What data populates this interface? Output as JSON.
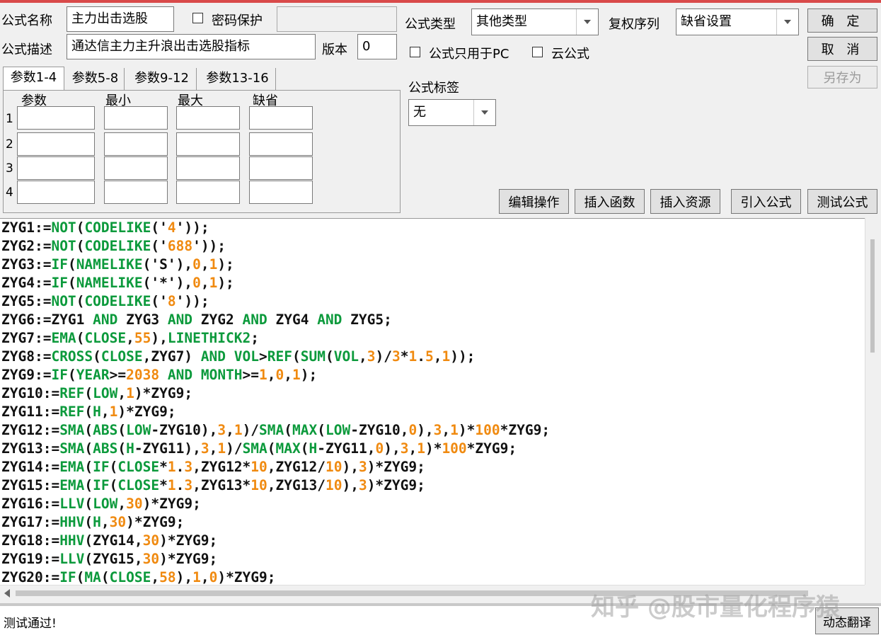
{
  "header": {
    "name_label": "公式名称",
    "name_value": "主力出击选股",
    "password_label": "密码保护",
    "desc_label": "公式描述",
    "desc_value": "通达信主力主升浪出击选股指标",
    "version_label": "版本",
    "version_value": "0",
    "type_label": "公式类型",
    "type_value": "其他类型",
    "rights_label": "复权序列",
    "rights_value": "缺省设置",
    "pc_only_label": "公式只用于PC",
    "cloud_label": "云公式",
    "tag_label": "公式标签",
    "tag_value": "无"
  },
  "buttons": {
    "ok": "确 定",
    "cancel": "取 消",
    "save_as": "另存为",
    "edit_ops": "编辑操作",
    "insert_func": "插入函数",
    "insert_res": "插入资源",
    "import_formula": "引入公式",
    "test_formula": "测试公式",
    "dynamic_translate": "动态翻译"
  },
  "param_tabs": [
    "参数1-4",
    "参数5-8",
    "参数9-12",
    "参数13-16"
  ],
  "param_headers": [
    "参数",
    "最小",
    "最大",
    "缺省"
  ],
  "param_rows": [
    "1",
    "2",
    "3",
    "4"
  ],
  "code_lines": [
    [
      [
        "t",
        "ZYG1:="
      ],
      [
        "f",
        "NOT"
      ],
      [
        "t",
        "("
      ],
      [
        "f",
        "CODELIKE"
      ],
      [
        "t",
        "('"
      ],
      [
        "n",
        "4"
      ],
      [
        "t",
        "'));"
      ]
    ],
    [
      [
        "t",
        "ZYG2:="
      ],
      [
        "f",
        "NOT"
      ],
      [
        "t",
        "("
      ],
      [
        "f",
        "CODELIKE"
      ],
      [
        "t",
        "('"
      ],
      [
        "n",
        "688"
      ],
      [
        "t",
        "'));"
      ]
    ],
    [
      [
        "t",
        "ZYG3:="
      ],
      [
        "f",
        "IF"
      ],
      [
        "t",
        "("
      ],
      [
        "f",
        "NAMELIKE"
      ],
      [
        "t",
        "('S'),"
      ],
      [
        "n",
        "0"
      ],
      [
        "t",
        ","
      ],
      [
        "n",
        "1"
      ],
      [
        "t",
        ");"
      ]
    ],
    [
      [
        "t",
        "ZYG4:="
      ],
      [
        "f",
        "IF"
      ],
      [
        "t",
        "("
      ],
      [
        "f",
        "NAMELIKE"
      ],
      [
        "t",
        "('*'),"
      ],
      [
        "n",
        "0"
      ],
      [
        "t",
        ","
      ],
      [
        "n",
        "1"
      ],
      [
        "t",
        ");"
      ]
    ],
    [
      [
        "t",
        "ZYG5:="
      ],
      [
        "f",
        "NOT"
      ],
      [
        "t",
        "("
      ],
      [
        "f",
        "CODELIKE"
      ],
      [
        "t",
        "('"
      ],
      [
        "n",
        "8"
      ],
      [
        "t",
        "'));"
      ]
    ],
    [
      [
        "t",
        "ZYG6:=ZYG1 "
      ],
      [
        "f",
        "AND"
      ],
      [
        "t",
        " ZYG3 "
      ],
      [
        "f",
        "AND"
      ],
      [
        "t",
        " ZYG2 "
      ],
      [
        "f",
        "AND"
      ],
      [
        "t",
        " ZYG4 "
      ],
      [
        "f",
        "AND"
      ],
      [
        "t",
        " ZYG5;"
      ]
    ],
    [
      [
        "t",
        "ZYG7:="
      ],
      [
        "f",
        "EMA"
      ],
      [
        "t",
        "("
      ],
      [
        "f",
        "CLOSE"
      ],
      [
        "t",
        ","
      ],
      [
        "n",
        "55"
      ],
      [
        "t",
        "),"
      ],
      [
        "f",
        "LINETHICK2"
      ],
      [
        "t",
        ";"
      ]
    ],
    [
      [
        "t",
        "ZYG8:="
      ],
      [
        "f",
        "CROSS"
      ],
      [
        "t",
        "("
      ],
      [
        "f",
        "CLOSE"
      ],
      [
        "t",
        ",ZYG7) "
      ],
      [
        "f",
        "AND"
      ],
      [
        "t",
        " "
      ],
      [
        "f",
        "VOL"
      ],
      [
        "t",
        ">"
      ],
      [
        "f",
        "REF"
      ],
      [
        "t",
        "("
      ],
      [
        "f",
        "SUM"
      ],
      [
        "t",
        "("
      ],
      [
        "f",
        "VOL"
      ],
      [
        "t",
        ","
      ],
      [
        "n",
        "3"
      ],
      [
        "t",
        ")/"
      ],
      [
        "n",
        "3"
      ],
      [
        "t",
        "*"
      ],
      [
        "n",
        "1"
      ],
      [
        "t",
        "."
      ],
      [
        "n",
        "5"
      ],
      [
        "t",
        ","
      ],
      [
        "n",
        "1"
      ],
      [
        "t",
        "));"
      ]
    ],
    [
      [
        "t",
        "ZYG9:="
      ],
      [
        "f",
        "IF"
      ],
      [
        "t",
        "("
      ],
      [
        "f",
        "YEAR"
      ],
      [
        "t",
        ">="
      ],
      [
        "n",
        "2038"
      ],
      [
        "t",
        " "
      ],
      [
        "f",
        "AND"
      ],
      [
        "t",
        " "
      ],
      [
        "f",
        "MONTH"
      ],
      [
        "t",
        ">="
      ],
      [
        "n",
        "1"
      ],
      [
        "t",
        ","
      ],
      [
        "n",
        "0"
      ],
      [
        "t",
        ","
      ],
      [
        "n",
        "1"
      ],
      [
        "t",
        ");"
      ]
    ],
    [
      [
        "t",
        "ZYG10:="
      ],
      [
        "f",
        "REF"
      ],
      [
        "t",
        "("
      ],
      [
        "f",
        "LOW"
      ],
      [
        "t",
        ","
      ],
      [
        "n",
        "1"
      ],
      [
        "t",
        ")*ZYG9;"
      ]
    ],
    [
      [
        "t",
        "ZYG11:="
      ],
      [
        "f",
        "REF"
      ],
      [
        "t",
        "("
      ],
      [
        "f",
        "H"
      ],
      [
        "t",
        ","
      ],
      [
        "n",
        "1"
      ],
      [
        "t",
        ")*ZYG9;"
      ]
    ],
    [
      [
        "t",
        "ZYG12:="
      ],
      [
        "f",
        "SMA"
      ],
      [
        "t",
        "("
      ],
      [
        "f",
        "ABS"
      ],
      [
        "t",
        "("
      ],
      [
        "f",
        "LOW"
      ],
      [
        "t",
        "-ZYG10),"
      ],
      [
        "n",
        "3"
      ],
      [
        "t",
        ","
      ],
      [
        "n",
        "1"
      ],
      [
        "t",
        ")/"
      ],
      [
        "f",
        "SMA"
      ],
      [
        "t",
        "("
      ],
      [
        "f",
        "MAX"
      ],
      [
        "t",
        "("
      ],
      [
        "f",
        "LOW"
      ],
      [
        "t",
        "-ZYG10,"
      ],
      [
        "n",
        "0"
      ],
      [
        "t",
        "),"
      ],
      [
        "n",
        "3"
      ],
      [
        "t",
        ","
      ],
      [
        "n",
        "1"
      ],
      [
        "t",
        ")*"
      ],
      [
        "n",
        "100"
      ],
      [
        "t",
        "*ZYG9;"
      ]
    ],
    [
      [
        "t",
        "ZYG13:="
      ],
      [
        "f",
        "SMA"
      ],
      [
        "t",
        "("
      ],
      [
        "f",
        "ABS"
      ],
      [
        "t",
        "("
      ],
      [
        "f",
        "H"
      ],
      [
        "t",
        "-ZYG11),"
      ],
      [
        "n",
        "3"
      ],
      [
        "t",
        ","
      ],
      [
        "n",
        "1"
      ],
      [
        "t",
        ")/"
      ],
      [
        "f",
        "SMA"
      ],
      [
        "t",
        "("
      ],
      [
        "f",
        "MAX"
      ],
      [
        "t",
        "("
      ],
      [
        "f",
        "H"
      ],
      [
        "t",
        "-ZYG11,"
      ],
      [
        "n",
        "0"
      ],
      [
        "t",
        "),"
      ],
      [
        "n",
        "3"
      ],
      [
        "t",
        ","
      ],
      [
        "n",
        "1"
      ],
      [
        "t",
        ")*"
      ],
      [
        "n",
        "100"
      ],
      [
        "t",
        "*ZYG9;"
      ]
    ],
    [
      [
        "t",
        "ZYG14:="
      ],
      [
        "f",
        "EMA"
      ],
      [
        "t",
        "("
      ],
      [
        "f",
        "IF"
      ],
      [
        "t",
        "("
      ],
      [
        "f",
        "CLOSE"
      ],
      [
        "t",
        "*"
      ],
      [
        "n",
        "1"
      ],
      [
        "t",
        "."
      ],
      [
        "n",
        "3"
      ],
      [
        "t",
        ",ZYG12*"
      ],
      [
        "n",
        "10"
      ],
      [
        "t",
        ",ZYG12/"
      ],
      [
        "n",
        "10"
      ],
      [
        "t",
        "),"
      ],
      [
        "n",
        "3"
      ],
      [
        "t",
        ")*ZYG9;"
      ]
    ],
    [
      [
        "t",
        "ZYG15:="
      ],
      [
        "f",
        "EMA"
      ],
      [
        "t",
        "("
      ],
      [
        "f",
        "IF"
      ],
      [
        "t",
        "("
      ],
      [
        "f",
        "CLOSE"
      ],
      [
        "t",
        "*"
      ],
      [
        "n",
        "1"
      ],
      [
        "t",
        "."
      ],
      [
        "n",
        "3"
      ],
      [
        "t",
        ",ZYG13*"
      ],
      [
        "n",
        "10"
      ],
      [
        "t",
        ",ZYG13/"
      ],
      [
        "n",
        "10"
      ],
      [
        "t",
        "),"
      ],
      [
        "n",
        "3"
      ],
      [
        "t",
        ")*ZYG9;"
      ]
    ],
    [
      [
        "t",
        "ZYG16:="
      ],
      [
        "f",
        "LLV"
      ],
      [
        "t",
        "("
      ],
      [
        "f",
        "LOW"
      ],
      [
        "t",
        ","
      ],
      [
        "n",
        "30"
      ],
      [
        "t",
        ")*ZYG9;"
      ]
    ],
    [
      [
        "t",
        "ZYG17:="
      ],
      [
        "f",
        "HHV"
      ],
      [
        "t",
        "("
      ],
      [
        "f",
        "H"
      ],
      [
        "t",
        ","
      ],
      [
        "n",
        "30"
      ],
      [
        "t",
        ")*ZYG9;"
      ]
    ],
    [
      [
        "t",
        "ZYG18:="
      ],
      [
        "f",
        "HHV"
      ],
      [
        "t",
        "(ZYG14,"
      ],
      [
        "n",
        "30"
      ],
      [
        "t",
        ")*ZYG9;"
      ]
    ],
    [
      [
        "t",
        "ZYG19:="
      ],
      [
        "f",
        "LLV"
      ],
      [
        "t",
        "(ZYG15,"
      ],
      [
        "n",
        "30"
      ],
      [
        "t",
        ")*ZYG9;"
      ]
    ],
    [
      [
        "t",
        "ZYG20:="
      ],
      [
        "f",
        "IF"
      ],
      [
        "t",
        "("
      ],
      [
        "f",
        "MA"
      ],
      [
        "t",
        "("
      ],
      [
        "f",
        "CLOSE"
      ],
      [
        "t",
        ","
      ],
      [
        "n",
        "58"
      ],
      [
        "t",
        "),"
      ],
      [
        "n",
        "1"
      ],
      [
        "t",
        ","
      ],
      [
        "n",
        "0"
      ],
      [
        "t",
        ")*ZYG9;"
      ]
    ]
  ],
  "status_text": "测试通过!",
  "watermark": "知乎 @股市量化程序猿"
}
